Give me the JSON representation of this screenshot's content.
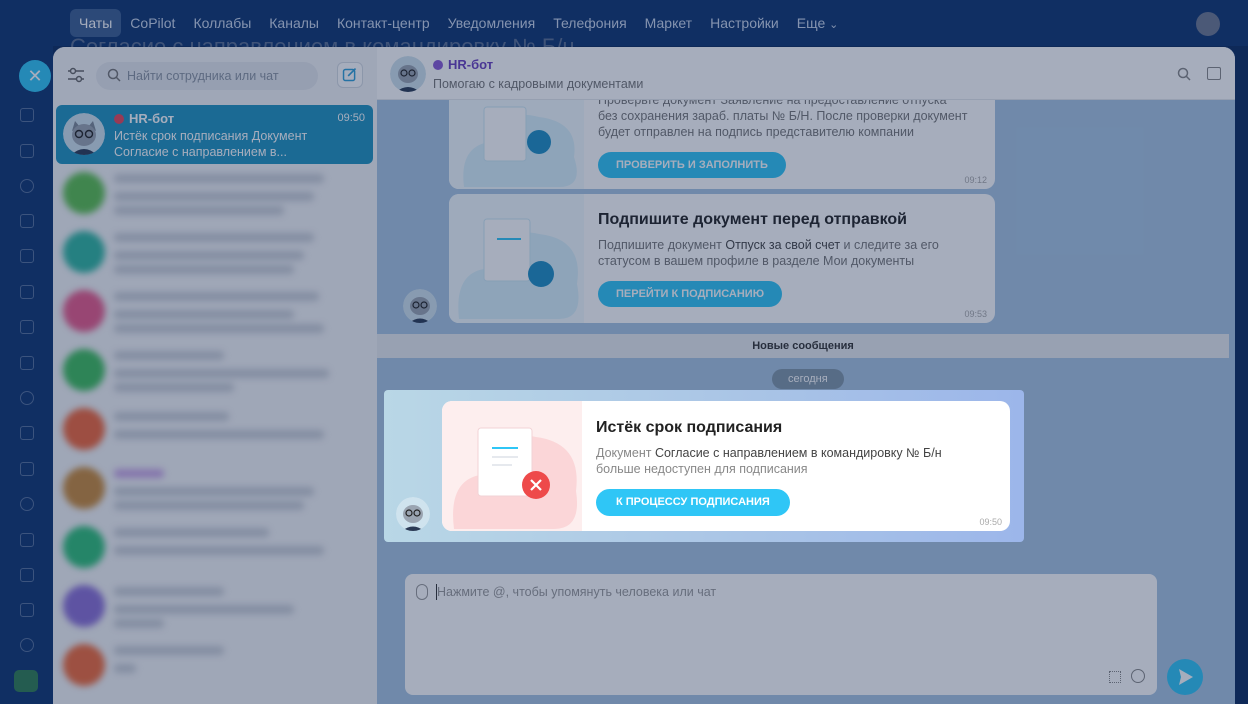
{
  "topnav": {
    "items": [
      "Чаты",
      "CoPilot",
      "Коллабы",
      "Каналы",
      "Контакт-центр",
      "Уведомления",
      "Телефония",
      "Маркет",
      "Настройки",
      "Еще"
    ],
    "more_chevron": "⌄"
  },
  "background_title": "Согласие с направлением в командировку № Б/н",
  "sidebar": {
    "search_placeholder": "Найти сотрудника или чат",
    "active_chat": {
      "name": "HR-бот",
      "time": "09:50",
      "preview": "Истёк срок подписания Документ Согласие с направлением в..."
    },
    "blurred_colors": [
      "#5bbf4e",
      "#2fb6a0",
      "#e85a8a",
      "#3ebd5c",
      "#f0663a",
      "#c98a3a",
      "#2fbf78",
      "#8b6fd6",
      "#f06a3a"
    ]
  },
  "header": {
    "title": "HR-бот",
    "subtitle": "Помогаю с кадровыми документами"
  },
  "messages": {
    "card1": {
      "text_pre": "Проверьте документ Заявление на предоставление отпуска без сохранения зараб. платы № Б/Н. После проверки документ будет отправлен на подпись представителю компании",
      "button": "ПРОВЕРИТЬ И ЗАПОЛНИТЬ",
      "time": "09:12"
    },
    "card2": {
      "title": "Подпишите документ перед отправкой",
      "text_a": "Подпишите документ ",
      "doc": "Отпуск за свой счет",
      "text_b": " и следите за его статусом в вашем профиле в разделе Мои документы",
      "button": "ПЕРЕЙТИ К ПОДПИСАНИЮ",
      "time": "09:53"
    },
    "new_messages": "Новые сообщения",
    "day": "сегодня",
    "highlight": {
      "title": "Истёк срок подписания",
      "text_a": "Документ ",
      "doc": "Согласие с направлением в командировку № Б/н",
      "text_b": " больше недоступен для подписания",
      "button": "К ПРОЦЕССУ ПОДПИСАНИЯ",
      "time": "09:50"
    }
  },
  "composer": {
    "placeholder": "Нажмите @, чтобы упомянуть человека или чат"
  },
  "colors": {
    "accent": "#2fc6f6",
    "active_chat": "#1f93bf",
    "error": "#e8465a"
  }
}
